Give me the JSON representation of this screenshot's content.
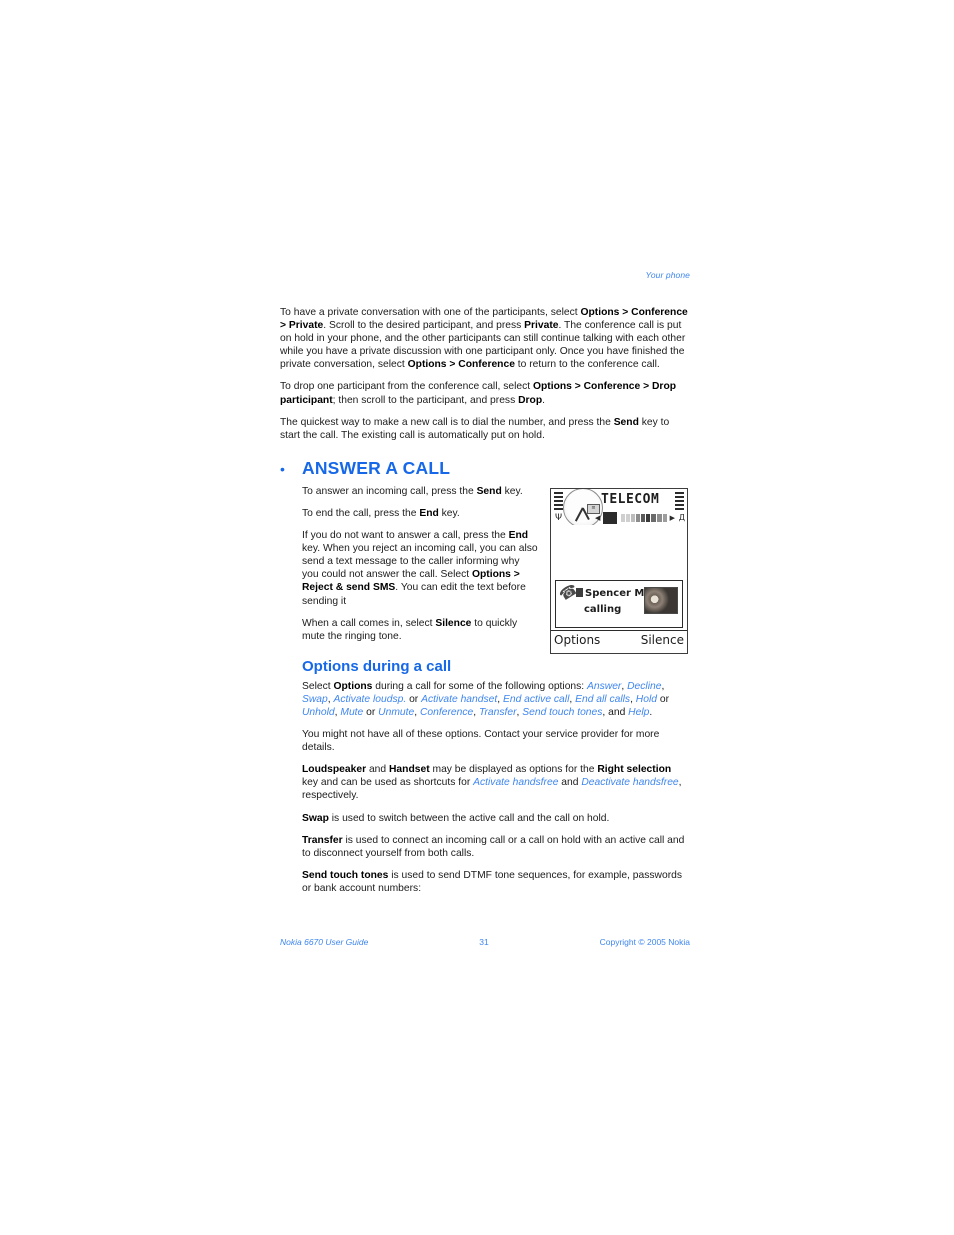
{
  "running_head": "Your phone",
  "intro_paragraphs": [
    {
      "runs": [
        {
          "t": "To have a private conversation with one of the participants, select ",
          "s": "normal"
        },
        {
          "t": "Options > Conference > Private",
          "s": "bold"
        },
        {
          "t": ". Scroll to the desired participant, and press ",
          "s": "normal"
        },
        {
          "t": "Private",
          "s": "bold"
        },
        {
          "t": ". The conference call is put on hold in your phone, and the other participants can still continue talking with each other while you have a private discussion with one participant only. Once you have finished the private conversation, select ",
          "s": "normal"
        },
        {
          "t": "Options > Conference",
          "s": "bold"
        },
        {
          "t": " to return to the conference call.",
          "s": "normal"
        }
      ]
    },
    {
      "runs": [
        {
          "t": "To drop one participant from the conference call, select ",
          "s": "normal"
        },
        {
          "t": "Options > Conference > Drop participant",
          "s": "bold"
        },
        {
          "t": "; then scroll to the participant, and press ",
          "s": "normal"
        },
        {
          "t": "Drop",
          "s": "bold"
        },
        {
          "t": ".",
          "s": "normal"
        }
      ]
    },
    {
      "runs": [
        {
          "t": "The quickest way to make a new call is to dial the number, and press the ",
          "s": "normal"
        },
        {
          "t": "Send",
          "s": "bold"
        },
        {
          "t": " key to start the call. The existing call is automatically put on hold.",
          "s": "normal"
        }
      ]
    }
  ],
  "chapter": {
    "bullet": "•",
    "title": "ANSWER A CALL",
    "paragraphs": [
      {
        "runs": [
          {
            "t": "To answer an incoming call, press the ",
            "s": "normal"
          },
          {
            "t": "Send",
            "s": "bold"
          },
          {
            "t": " key.",
            "s": "normal"
          }
        ]
      },
      {
        "runs": [
          {
            "t": "To end the call, press the ",
            "s": "normal"
          },
          {
            "t": "End",
            "s": "bold"
          },
          {
            "t": " key.",
            "s": "normal"
          }
        ]
      },
      {
        "runs": [
          {
            "t": "If you do not want to answer a call, press the ",
            "s": "normal"
          },
          {
            "t": "End",
            "s": "bold"
          },
          {
            "t": " key. When you reject an incoming call, you can also send a text message to the caller informing why you could not answer the call. Select ",
            "s": "normal"
          },
          {
            "t": "Options > Reject & send SMS",
            "s": "bold"
          },
          {
            "t": ". You can edit the text before sending it",
            "s": "normal"
          }
        ]
      },
      {
        "runs": [
          {
            "t": "When a call comes in, select ",
            "s": "normal"
          },
          {
            "t": "Silence",
            "s": "bold"
          },
          {
            "t": " to quickly mute the ringing tone.",
            "s": "normal"
          }
        ]
      }
    ]
  },
  "phone_screen": {
    "operator": "TELECOM",
    "antenna_icon": "Ψ",
    "arrow_left_icon": "◀",
    "arrow_right_icon": "▶",
    "battery_icon": "Д",
    "clock_badge": "≡",
    "caller_name": "Spencer M...",
    "caller_status": "calling",
    "softkey_left": "Options",
    "softkey_right": "Silence"
  },
  "section": {
    "title": "Options during a call",
    "paragraphs": [
      {
        "runs": [
          {
            "t": "Select ",
            "s": "normal"
          },
          {
            "t": "Options",
            "s": "bold"
          },
          {
            "t": " during a call for some of the following options: ",
            "s": "normal"
          },
          {
            "t": "Answer",
            "s": "link"
          },
          {
            "t": ", ",
            "s": "normal"
          },
          {
            "t": "Decline",
            "s": "link"
          },
          {
            "t": ", ",
            "s": "normal"
          },
          {
            "t": "Swap",
            "s": "link"
          },
          {
            "t": ", ",
            "s": "normal"
          },
          {
            "t": "Activate loudsp.",
            "s": "link"
          },
          {
            "t": " or ",
            "s": "normal"
          },
          {
            "t": "Activate handset",
            "s": "link"
          },
          {
            "t": ", ",
            "s": "normal"
          },
          {
            "t": "End active call",
            "s": "link"
          },
          {
            "t": ", ",
            "s": "normal"
          },
          {
            "t": "End all calls",
            "s": "link"
          },
          {
            "t": ", ",
            "s": "normal"
          },
          {
            "t": "Hold",
            "s": "link"
          },
          {
            "t": " or ",
            "s": "normal"
          },
          {
            "t": "Unhold",
            "s": "link"
          },
          {
            "t": ", ",
            "s": "normal"
          },
          {
            "t": "Mute",
            "s": "link"
          },
          {
            "t": " or ",
            "s": "normal"
          },
          {
            "t": "Unmute",
            "s": "link"
          },
          {
            "t": ", ",
            "s": "normal"
          },
          {
            "t": "Conference",
            "s": "link"
          },
          {
            "t": ", ",
            "s": "normal"
          },
          {
            "t": "Transfer",
            "s": "link"
          },
          {
            "t": ", ",
            "s": "normal"
          },
          {
            "t": "Send touch tones",
            "s": "link"
          },
          {
            "t": ", and ",
            "s": "normal"
          },
          {
            "t": "Help",
            "s": "link"
          },
          {
            "t": ".",
            "s": "normal"
          }
        ]
      },
      {
        "runs": [
          {
            "t": "You might not have all of these options. Contact your service provider for more details.",
            "s": "normal"
          }
        ]
      },
      {
        "runs": [
          {
            "t": "Loudspeaker",
            "s": "bold"
          },
          {
            "t": " and ",
            "s": "normal"
          },
          {
            "t": "Handset",
            "s": "bold"
          },
          {
            "t": " may be displayed as options for the ",
            "s": "normal"
          },
          {
            "t": "Right selection",
            "s": "bold"
          },
          {
            "t": " key and can be used as shortcuts for ",
            "s": "normal"
          },
          {
            "t": "Activate handsfree",
            "s": "link"
          },
          {
            "t": " and ",
            "s": "normal"
          },
          {
            "t": "Deactivate handsfree",
            "s": "link"
          },
          {
            "t": ", respectively.",
            "s": "normal"
          }
        ]
      },
      {
        "runs": [
          {
            "t": "Swap",
            "s": "bold"
          },
          {
            "t": " is used to switch between the active call and the call on hold.",
            "s": "normal"
          }
        ]
      },
      {
        "runs": [
          {
            "t": "Transfer",
            "s": "bold"
          },
          {
            "t": " is used to connect an incoming call or a call on hold with an active call and to disconnect yourself from both calls.",
            "s": "normal"
          }
        ]
      },
      {
        "runs": [
          {
            "t": "Send touch tones",
            "s": "bold"
          },
          {
            "t": " is used to send DTMF tone sequences, for example, passwords or bank account numbers:",
            "s": "normal"
          }
        ]
      }
    ]
  },
  "footer": {
    "left": "Nokia 6670 User Guide",
    "center": "31",
    "right": "Copyright © 2005 Nokia"
  },
  "colors": {
    "heading_blue": "#1668e8",
    "link_blue": "#3f86ef",
    "body_text": "#1c1c1c"
  }
}
